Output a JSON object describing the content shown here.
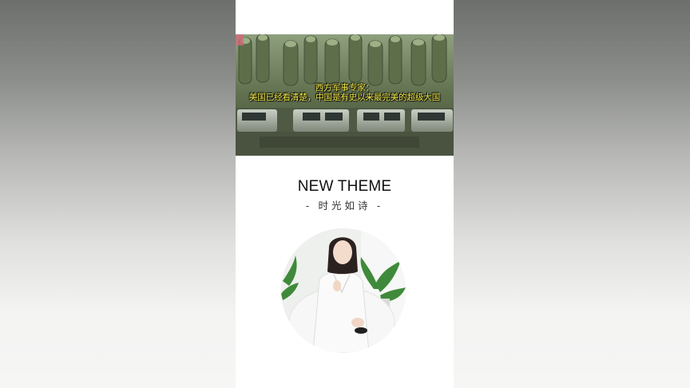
{
  "video": {
    "caption_line1": "西方军事专家：",
    "caption_line2": "美国已经看清楚，中国是有史以来最完美的超级大国"
  },
  "profile": {
    "title": "NEW THEME",
    "subtitle": "- 时光如诗 -"
  },
  "icons": {
    "avatar": "woman-portrait-avatar"
  },
  "colors": {
    "caption": "#f4e94a",
    "page_background": "#ffffff"
  }
}
